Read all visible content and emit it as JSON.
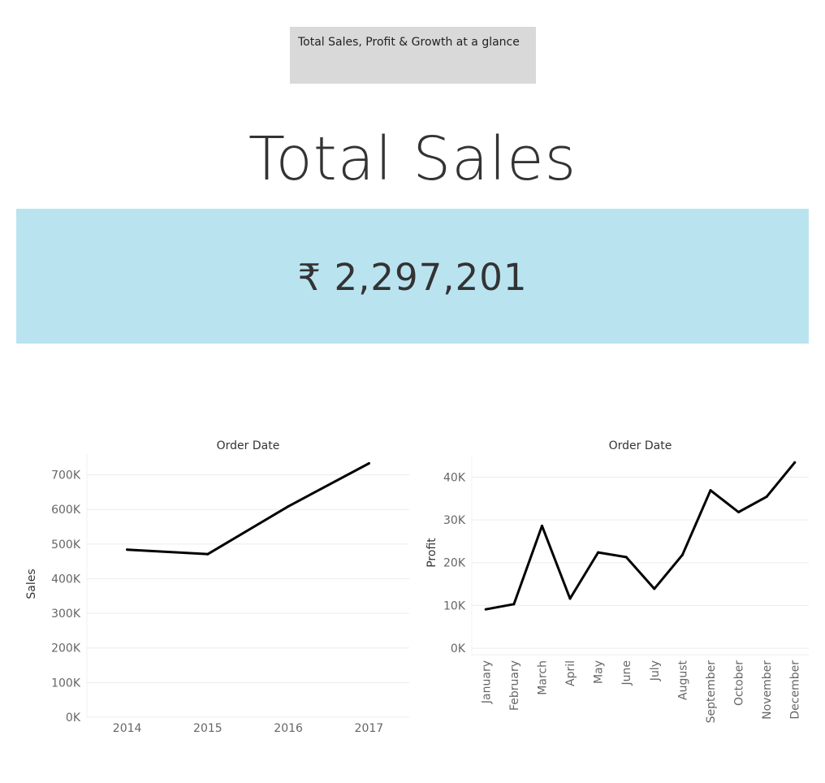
{
  "header": {
    "subtitle": "Total Sales, Profit & Growth at a glance",
    "title": "Total Sales"
  },
  "kpi": {
    "value": "₹ 2,297,201",
    "background": "#bae3f0"
  },
  "chart_data": [
    {
      "type": "line",
      "title": "Order Date",
      "xlabel": "",
      "ylabel": "Sales",
      "categories": [
        "2014",
        "2015",
        "2016",
        "2017"
      ],
      "values": [
        484000,
        471000,
        609000,
        733000
      ],
      "ylim": [
        0,
        760000
      ],
      "yticks": [
        0,
        100000,
        200000,
        300000,
        400000,
        500000,
        600000,
        700000
      ],
      "ytick_labels": [
        "0K",
        "100K",
        "200K",
        "300K",
        "400K",
        "500K",
        "600K",
        "700K"
      ],
      "grid": true,
      "line_color": "#000000"
    },
    {
      "type": "line",
      "title": "Order Date",
      "xlabel": "",
      "ylabel": "Profit",
      "categories": [
        "January",
        "February",
        "March",
        "April",
        "May",
        "June",
        "July",
        "August",
        "September",
        "October",
        "November",
        "December"
      ],
      "values": [
        9100,
        10300,
        28600,
        11600,
        22400,
        21300,
        13900,
        21800,
        36900,
        31800,
        35400,
        43400
      ],
      "ylim": [
        -1500,
        45000
      ],
      "yticks": [
        0,
        10000,
        20000,
        30000,
        40000
      ],
      "ytick_labels": [
        "0K",
        "10K",
        "20K",
        "30K",
        "40K"
      ],
      "grid": true,
      "line_color": "#000000"
    }
  ]
}
